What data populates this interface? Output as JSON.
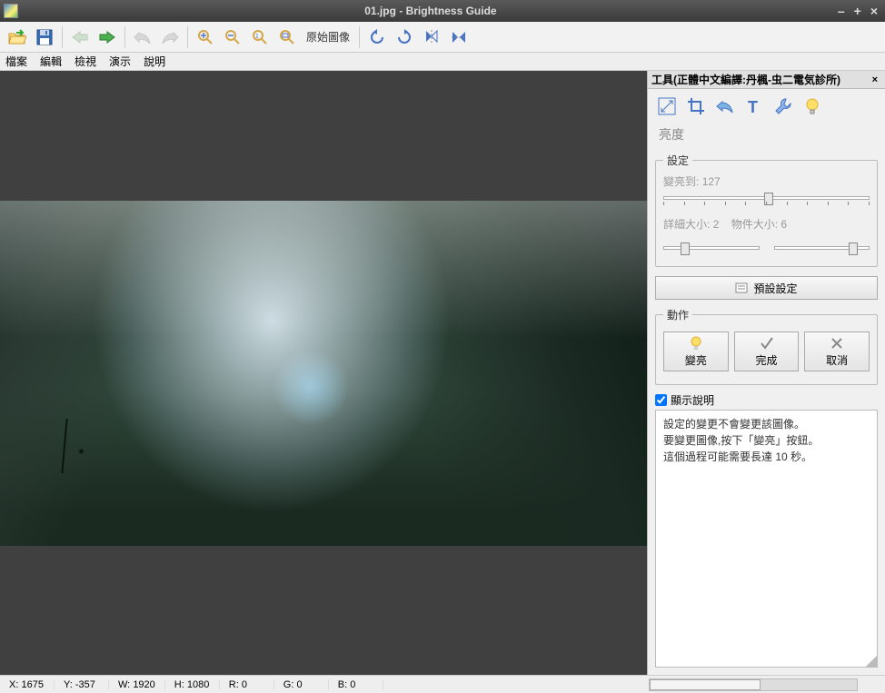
{
  "window": {
    "title": "01.jpg - Brightness Guide"
  },
  "toolbar": {
    "original_label": "原始圖像"
  },
  "menu": {
    "file": "檔案",
    "edit": "編輯",
    "view": "檢視",
    "demo": "演示",
    "help": "說明"
  },
  "panel": {
    "title": "工具(正體中文編譯:丹楓-虫二電気診所)",
    "section": "亮度",
    "settings_legend": "設定",
    "brighten_to_label": "變亮到:",
    "brighten_to_value": "127",
    "detail_label": "詳細大小:",
    "detail_value": "2",
    "object_label": "物件大小:",
    "object_value": "6",
    "preset_label": "預設設定",
    "actions_legend": "動作",
    "brighten_btn": "變亮",
    "done_btn": "完成",
    "cancel_btn": "取消",
    "show_help_label": "顯示說明",
    "help_line1": "設定的變更不會變更該圖像。",
    "help_line2": "要變更圖像,按下「變亮」按鈕。",
    "help_line3": "這個過程可能需要長達 10 秒。"
  },
  "status": {
    "x_label": "X:",
    "x_val": "1675",
    "y_label": "Y:",
    "y_val": "-357",
    "w_label": "W:",
    "w_val": "1920",
    "h_label": "H:",
    "h_val": "1080",
    "r_label": "R:",
    "r_val": "0",
    "g_label": "G:",
    "g_val": "0",
    "b_label": "B:",
    "b_val": "0"
  }
}
